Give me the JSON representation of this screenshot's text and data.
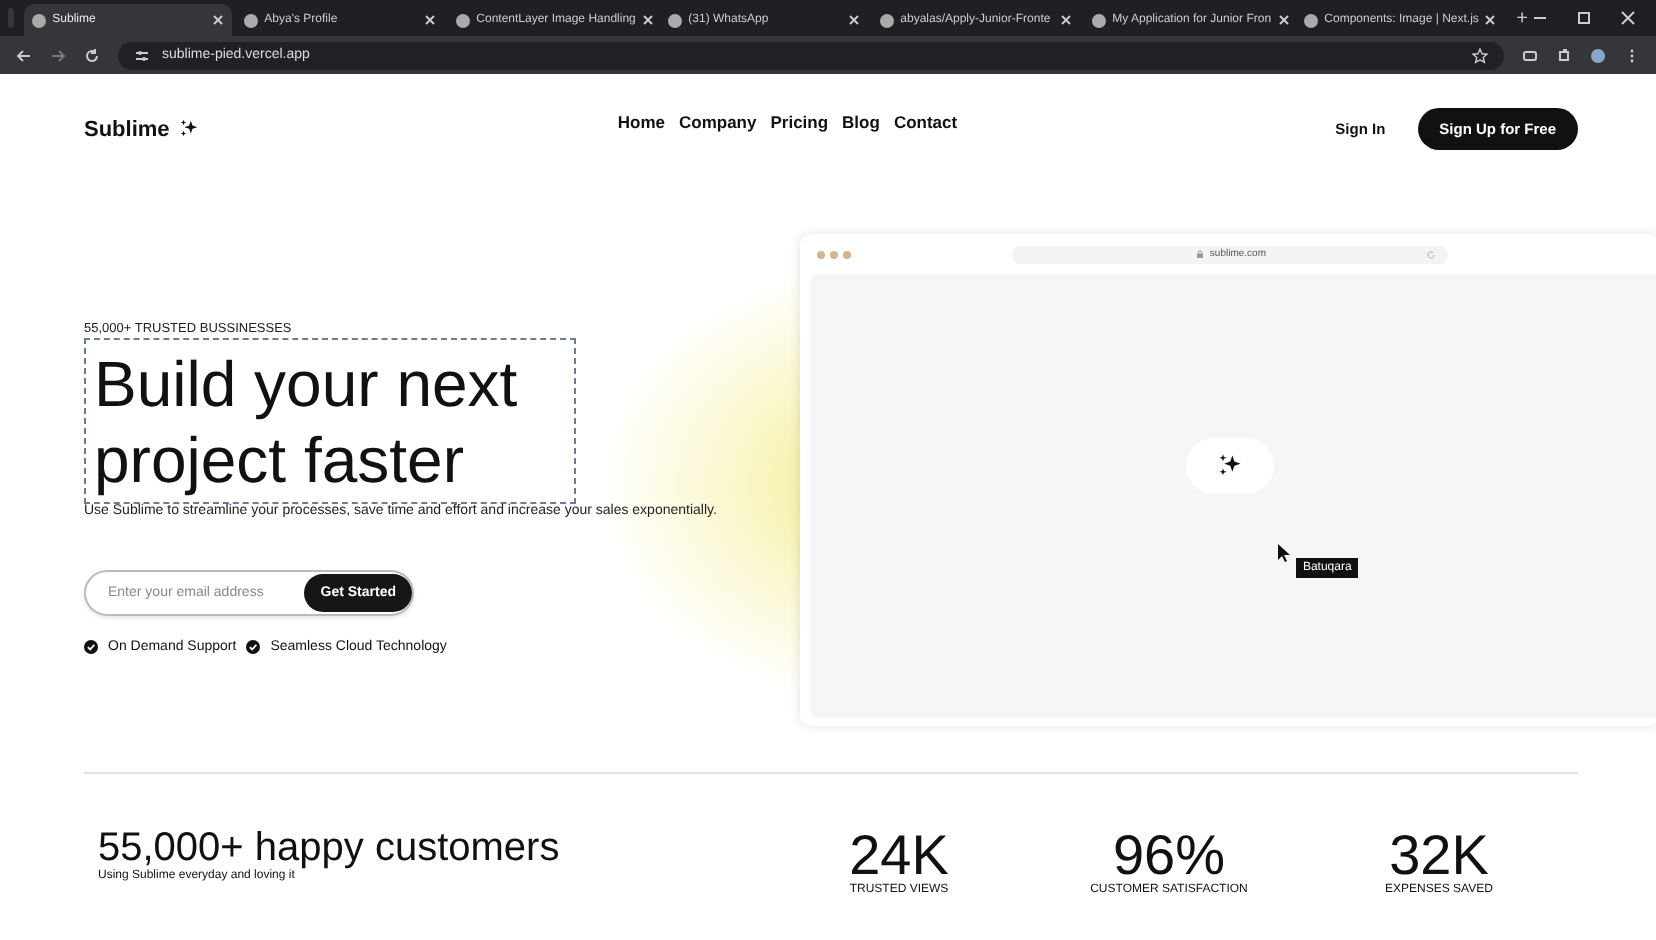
{
  "browser": {
    "tabs": [
      {
        "label": "Sublime",
        "selected": true
      },
      {
        "label": "Abya's Profile",
        "selected": false
      },
      {
        "label": "ContentLayer Image Handling",
        "selected": false
      },
      {
        "label": "(31) WhatsApp",
        "selected": false
      },
      {
        "label": "abyalas/Apply-Junior-Fronte",
        "selected": false
      },
      {
        "label": "My Application for Junior Fron",
        "selected": false
      },
      {
        "label": "Components: Image | Next.js",
        "selected": false
      }
    ],
    "new_tab": "+",
    "address": "sublime-pied.vercel.app"
  },
  "nav": {
    "logo": "Sublime",
    "links": [
      "Home",
      "Company",
      "Pricing",
      "Blog",
      "Contact"
    ],
    "sign_in": "Sign In",
    "sign_up": "Sign Up for Free"
  },
  "hero": {
    "eyebrow": "55,000+ TRUSTED BUSSINESSES",
    "headline": "Build your next project faster",
    "description": "Use Sublime to streamline your processes, save time and effort and increase your sales exponentially.",
    "email": {
      "placeholder": "Enter your email address"
    },
    "cta": "Get Started",
    "features": [
      "On Demand Support",
      "Seamless Cloud Technology"
    ]
  },
  "preview": {
    "address": "sublime.com",
    "tooltip": "Batuqara"
  },
  "stats": {
    "headline": "55,000+ happy customers",
    "subline": "Using Sublime everyday and loving it",
    "items": [
      {
        "value": "24K",
        "label": "TRUSTED VIEWS"
      },
      {
        "value": "96%",
        "label": "CUSTOMER SATISFACTION"
      },
      {
        "value": "32K",
        "label": "EXPENSES SAVED"
      }
    ]
  }
}
